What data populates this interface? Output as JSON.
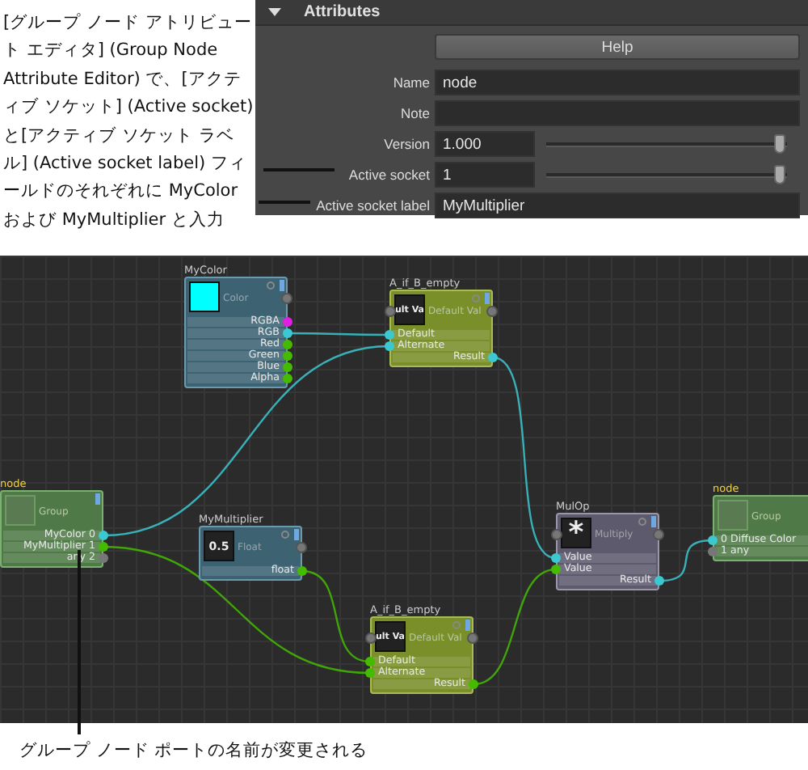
{
  "callout_top": {
    "text": "[グループ ノード アトリビュート エディタ] (Group Node Attribute Editor) で、[アクティブ ソケット] (Active socket) と[アクティブ ソケット ラベル] (Active socket label) フィールドのそれぞれに MyColor および MyMultiplier と入力"
  },
  "attributes_panel": {
    "title": "Attributes",
    "expanded": true,
    "help_button": "Help",
    "fields": [
      {
        "kind": "text",
        "label": "Name",
        "value": "node"
      },
      {
        "kind": "text",
        "label": "Note"
      },
      {
        "kind": "slider",
        "label": "Version",
        "value": "1.000",
        "level": 1
      },
      {
        "kind": "slider",
        "label": "Active socket",
        "value": "1",
        "level": 1
      },
      {
        "kind": "text",
        "label": "Active socket label",
        "value": "MyMultiplier"
      }
    ]
  },
  "graph": {
    "nodes": [
      {
        "kind": "color",
        "title": "MyColor",
        "type_label": "Color",
        "ports": [
          {
            "kind": "out",
            "name": "RGBA",
            "color": "#e020e0"
          },
          {
            "kind": "out",
            "name": "RGB",
            "color": "#3cc8d0"
          },
          {
            "kind": "out",
            "name": "Red",
            "color": "#44bb00"
          },
          {
            "kind": "out",
            "name": "Green",
            "color": "#44bb00"
          },
          {
            "kind": "out",
            "name": "Blue",
            "color": "#44bb00"
          },
          {
            "kind": "out",
            "name": "Alpha",
            "color": "#44bb00"
          }
        ]
      },
      {
        "kind": "if",
        "title": "A_if_B_empty",
        "thumb": "ult Va",
        "type_label": "Default Val",
        "ports": [
          {
            "kind": "in",
            "name": "Default",
            "color": "#3cc8d0"
          },
          {
            "kind": "in",
            "name": "Alternate",
            "color": "#3cc8d0"
          },
          {
            "kind": "out",
            "name": "Result",
            "color": "#3cc8d0"
          }
        ]
      },
      {
        "kind": "group",
        "title": "node",
        "type_label": "Group",
        "ports": [
          {
            "kind": "out",
            "name": "MyColor 0",
            "color": "#3cc8d0"
          },
          {
            "kind": "out",
            "name": "MyMultiplier 1",
            "color": "#44bb00"
          },
          {
            "kind": "out",
            "name": "any 2",
            "color": "#777777"
          }
        ]
      },
      {
        "kind": "value",
        "title": "MyMultiplier",
        "thumb": "0.5",
        "type_label": "Float",
        "ports": [
          {
            "kind": "out",
            "name": "float",
            "color": "#44bb00"
          }
        ]
      },
      {
        "kind": "if",
        "title": "A_if_B_empty",
        "thumb": "ult Va",
        "type_label": "Default Val",
        "ports": [
          {
            "kind": "in",
            "name": "Default",
            "color": "#44bb00"
          },
          {
            "kind": "in",
            "name": "Alternate",
            "color": "#44bb00"
          },
          {
            "kind": "out",
            "name": "Result",
            "color": "#44bb00"
          }
        ]
      },
      {
        "kind": "op",
        "title": "MulOp",
        "thumb": "*",
        "type_label": "Multiply",
        "ports": [
          {
            "kind": "in",
            "name": "Value",
            "color": "#3cc8d0"
          },
          {
            "kind": "in",
            "name": "Value",
            "color": "#44bb00"
          },
          {
            "kind": "out",
            "name": "Result",
            "color": "#3cc8d0"
          }
        ]
      },
      {
        "kind": "group",
        "title": "node",
        "type_label": "Group",
        "ports": [
          {
            "kind": "in",
            "name": "0 Diffuse Color",
            "color": "#3cc8d0"
          },
          {
            "kind": "in",
            "name": "1 any",
            "color": "#777777"
          }
        ]
      }
    ]
  },
  "callout_bottom": {
    "text": "グループ ノード ポートの名前が変更される"
  }
}
